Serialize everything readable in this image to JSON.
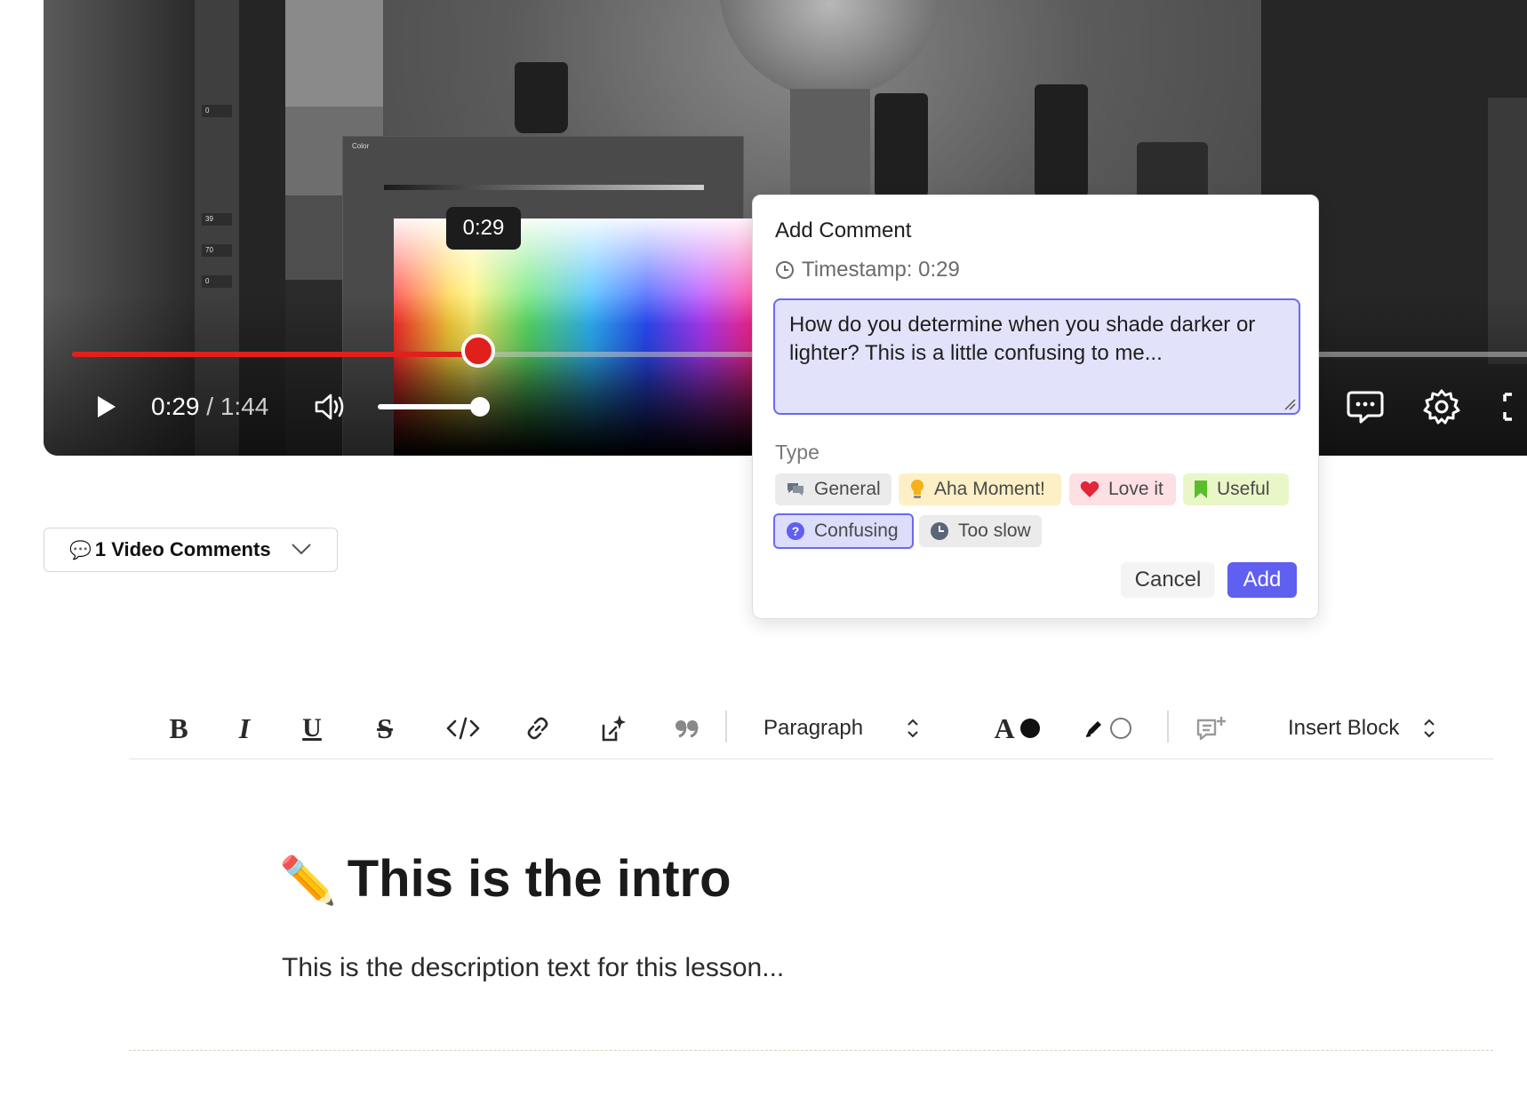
{
  "player": {
    "tooltip_time": "0:29",
    "current_time": "0:29",
    "duration": "1:44",
    "time_separator": " / ",
    "progress_fraction": 0.2788,
    "volume_fraction": 0.9,
    "accent_color": "#e0201c"
  },
  "comments_dropdown": {
    "icon": "💬",
    "label": "1 Video Comments"
  },
  "add_comment": {
    "title": "Add Comment",
    "timestamp_label": "Timestamp: 0:29",
    "comment_text": "How do you determine when you shade darker or lighter? This is a little confusing to me...",
    "type_label": "Type",
    "types": [
      {
        "label": "General",
        "icon": "speech-bubbles-icon"
      },
      {
        "label": "Aha Moment!",
        "icon": "lightbulb-icon"
      },
      {
        "label": "Love it",
        "icon": "heart-icon"
      },
      {
        "label": "Useful",
        "icon": "bookmark-icon"
      },
      {
        "label": "Confusing",
        "icon": "question-icon",
        "selected": true
      },
      {
        "label": "Too slow",
        "icon": "clock-icon"
      }
    ],
    "cancel_label": "Cancel",
    "add_label": "Add",
    "accent_color": "#5f5ff0"
  },
  "toolbar": {
    "bold": "B",
    "italic": "I",
    "underline": "U",
    "strike": "S",
    "paragraph_label": "Paragraph",
    "text_color_letter": "A",
    "insert_block_label": "Insert Block"
  },
  "lesson": {
    "title_emoji": "✏️",
    "title": "This is the intro",
    "description": "This is the description text for this lesson..."
  }
}
